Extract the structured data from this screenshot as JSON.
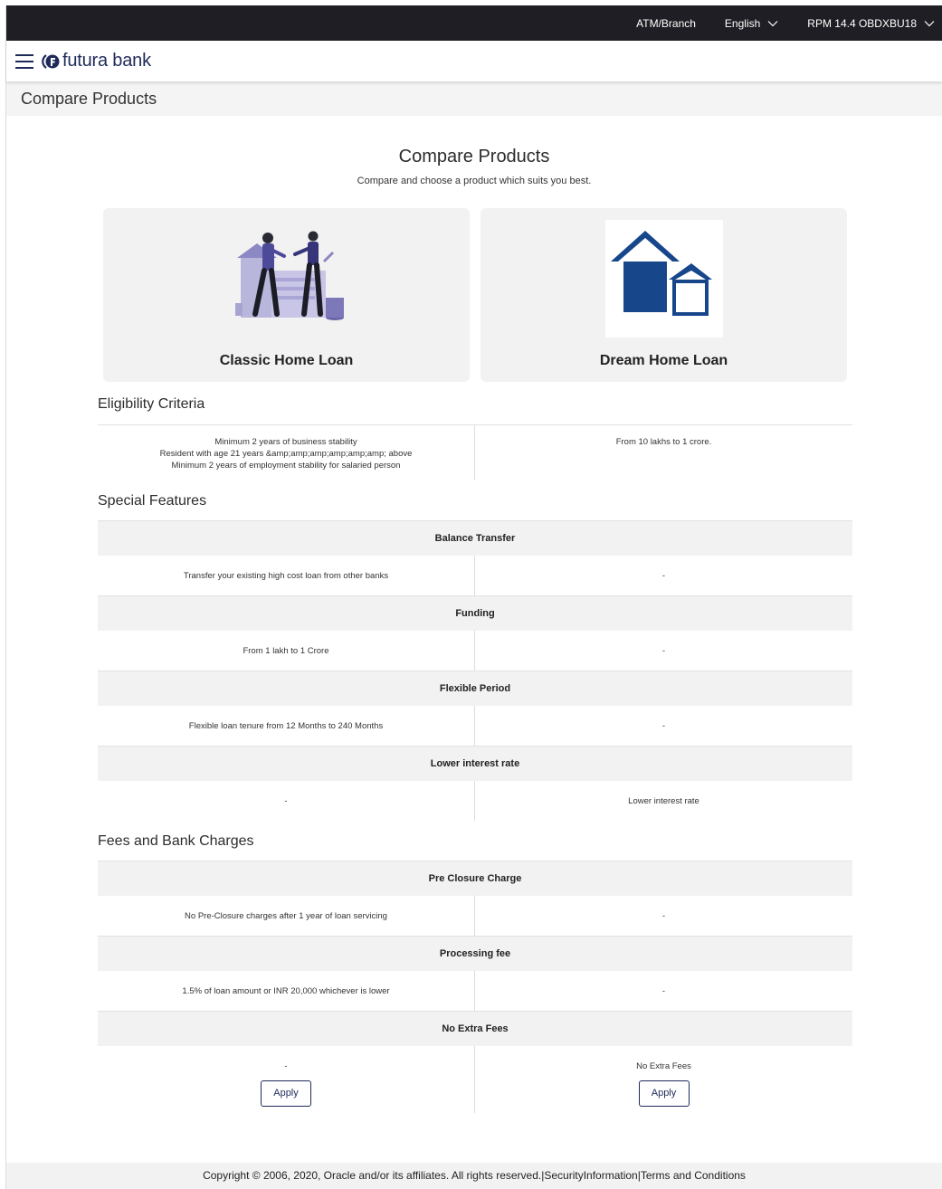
{
  "topbar": {
    "atm_branch": "ATM/Branch",
    "language": "English",
    "user": "RPM 14.4 OBDXBU18"
  },
  "header": {
    "brand": "futura bank",
    "brand_color": "#1e2a5a"
  },
  "breadcrumb": {
    "title": "Compare Products"
  },
  "main": {
    "heading": "Compare Products",
    "subheading": "Compare and choose a product which suits you best.",
    "products": [
      {
        "name": "Classic Home Loan",
        "image": "couple-house-illustration"
      },
      {
        "name": "Dream Home Loan",
        "image": "houses-icon"
      }
    ],
    "eligibility": {
      "title": "Eligibility Criteria",
      "left_lines": [
        "Minimum 2 years of business stability",
        "Resident with age 21 years &amp;amp;amp;amp;amp;amp; above",
        "Minimum 2 years of employment stability for salaried person"
      ],
      "right": "From 10 lakhs to 1 crore."
    },
    "special_features": {
      "title": "Special Features",
      "items": [
        {
          "name": "Balance Transfer",
          "left": "Transfer your existing high cost loan from other banks",
          "right": "-"
        },
        {
          "name": "Funding",
          "left": "From 1 lakh to 1 Crore",
          "right": "-"
        },
        {
          "name": "Flexible Period",
          "left": "Flexible loan tenure from 12 Months to 240 Months",
          "right": "-"
        },
        {
          "name": "Lower interest rate",
          "left": "-",
          "right": "Lower interest rate"
        }
      ]
    },
    "fees": {
      "title": "Fees and Bank Charges",
      "items": [
        {
          "name": "Pre Closure Charge",
          "left": "No Pre-Closure charges after 1 year of loan servicing",
          "right": "-"
        },
        {
          "name": "Processing fee",
          "left": "1.5% of loan amount or INR 20,000 whichever is lower",
          "right": "-"
        },
        {
          "name": "No Extra Fees",
          "left": "-",
          "right": "No Extra Fees"
        }
      ]
    },
    "apply_label": "Apply"
  },
  "footer": {
    "copyright": "Copyright © 2006, 2020, Oracle and/or its affiliates. All rights reserved.|",
    "security": "SecurityInformation",
    "separator": "|",
    "terms": "Terms and Conditions"
  }
}
